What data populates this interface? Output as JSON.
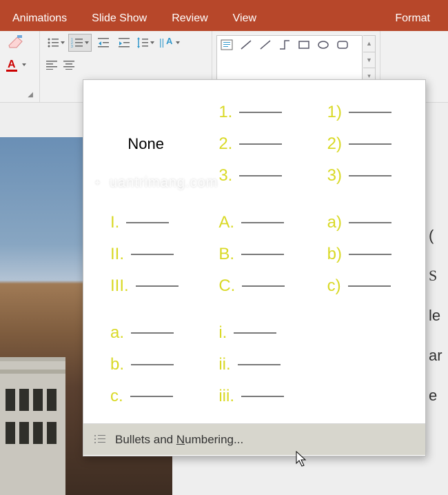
{
  "ribbon": {
    "tabs": [
      "Animations",
      "Slide Show",
      "Review",
      "View",
      "Format"
    ]
  },
  "numbering": {
    "none_label": "None",
    "styles": [
      [
        "1.",
        "2.",
        "3."
      ],
      [
        "1)",
        "2)",
        "3)"
      ],
      [
        "I.",
        "II.",
        "III."
      ],
      [
        "A.",
        "B.",
        "C."
      ],
      [
        "a)",
        "b)",
        "c)"
      ],
      [
        "a.",
        "b.",
        "c."
      ],
      [
        "i.",
        "ii.",
        "iii."
      ]
    ],
    "footer_prefix": "Bullets and ",
    "footer_underline": "N",
    "footer_suffix": "umbering..."
  },
  "watermark": "uantrimang.com",
  "sidetext": [
    "(",
    "S",
    "le",
    "ar",
    "e"
  ]
}
